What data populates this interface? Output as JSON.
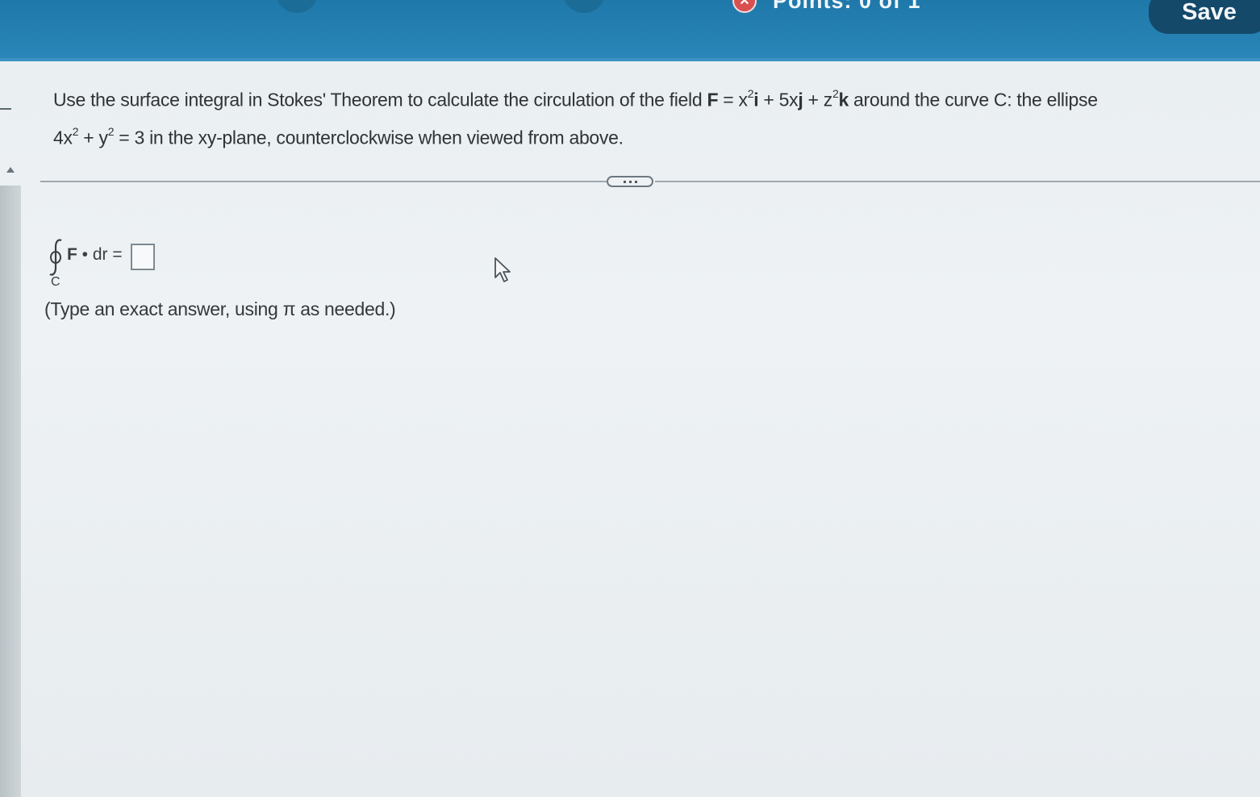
{
  "header": {
    "points_text": "Points: 0 of 1",
    "save_label": "Save"
  },
  "question": {
    "part1": "Use the surface integral in Stokes' Theorem to calculate the circulation of the field ",
    "field_label": "F",
    "field_expr_a": " = x",
    "exp1": "2",
    "field_i": "i",
    "field_expr_b": " + 5x",
    "field_j": "j",
    "field_expr_c": " + z",
    "exp2": "2",
    "field_k": "k",
    "part2": " around the curve C: the ellipse",
    "eq_a": "4x",
    "exp3": "2",
    "eq_b": " + y",
    "exp4": "2",
    "eq_c": " = 3 in the xy-plane, counterclockwise when viewed from above."
  },
  "answer": {
    "integrand_bold": "F",
    "integrand_rest": " • dr =",
    "subscript": "C",
    "hint": "(Type an exact answer, using π as needed.)"
  }
}
